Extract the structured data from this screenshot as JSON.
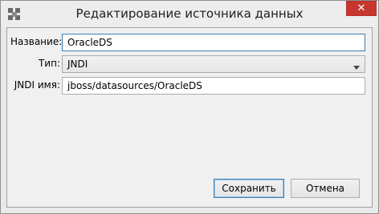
{
  "window": {
    "title": "Редактирование источника данных",
    "close_label": "✕"
  },
  "form": {
    "name_label": "Название:",
    "name_value": "OracleDS",
    "type_label": "Тип:",
    "type_value": "JNDI",
    "jndi_label": "JNDI имя:",
    "jndi_value": "jboss/datasources/OracleDS"
  },
  "buttons": {
    "save_label": "Сохранить",
    "cancel_label": "Отмена"
  },
  "icons": {
    "app": "app-grid-icon",
    "close": "close-icon",
    "dropdown": "chevron-down-icon"
  }
}
